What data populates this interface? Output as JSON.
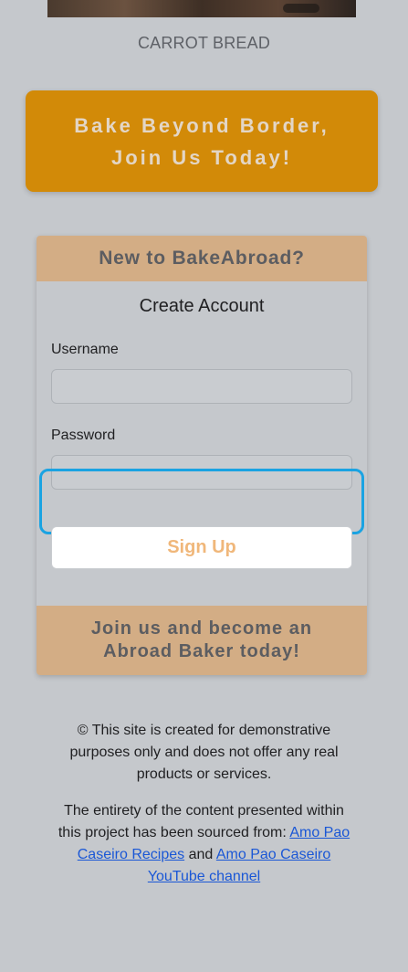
{
  "hero": {
    "caption": "CARROT BREAD"
  },
  "cta": {
    "line1": "Bake Beyond Border,",
    "line2": "Join Us Today!"
  },
  "signup_card": {
    "header": "New to BakeAbroad?",
    "form_title": "Create Account",
    "username_label": "Username",
    "username_value": "",
    "password_label": "Password",
    "password_value": "",
    "submit_label": "Sign Up",
    "footer_line1": "Join us and become an",
    "footer_line2": "Abroad Baker today!"
  },
  "footer": {
    "disclaimer": "© This site is created for demonstrative purposes only and does not offer any real products or services.",
    "attribution_prefix": "The entirety of the content presented within this project has been sourced from:",
    "link1_label": "Amo Pao Caseiro Recipes",
    "attribution_joiner": "and",
    "link2_label": "Amo Pao Caseiro YouTube channel"
  },
  "colors": {
    "background": "#c5c8cc",
    "cta_background": "#d28a08",
    "card_accent": "#d3ad85",
    "focus_ring": "#1aa3e2",
    "signup_text": "#f0b77a",
    "link": "#1a57d6"
  }
}
